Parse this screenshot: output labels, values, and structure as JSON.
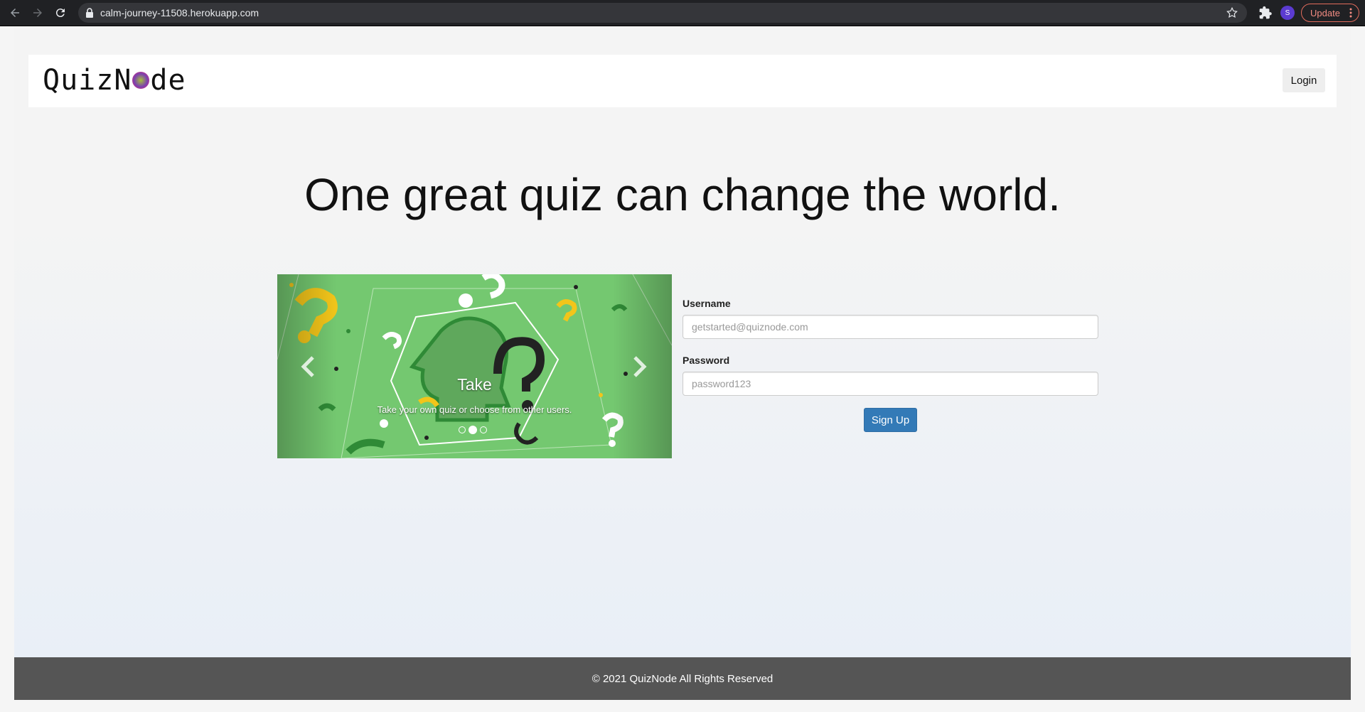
{
  "browser": {
    "url": "calm-journey-11508.herokuapp.com",
    "profile_initial": "S",
    "update_label": "Update",
    "icons": [
      "back-icon",
      "forward-icon",
      "reload-icon",
      "lock-icon",
      "star-icon",
      "extensions-icon",
      "menu-icon"
    ]
  },
  "navbar": {
    "logo_left": "QuizN",
    "logo_right": "de",
    "login_label": "Login"
  },
  "hero": {
    "headline": "One great quiz can change the world."
  },
  "carousel": {
    "slide_title": "Take",
    "slide_caption": "Take your own quiz or choose from other users.",
    "slide_count": 3,
    "active_slide": 2
  },
  "signup_form": {
    "username_label": "Username",
    "username_placeholder": "getstarted@quiznode.com",
    "password_label": "Password",
    "password_placeholder": "password123",
    "submit_label": "Sign Up"
  },
  "footer": {
    "text": "© 2021 QuizNode All Rights Reserved"
  },
  "colors": {
    "primary_button": "#337ab7",
    "footer_bg": "#555555",
    "carousel_bg": "#6ec66b"
  }
}
